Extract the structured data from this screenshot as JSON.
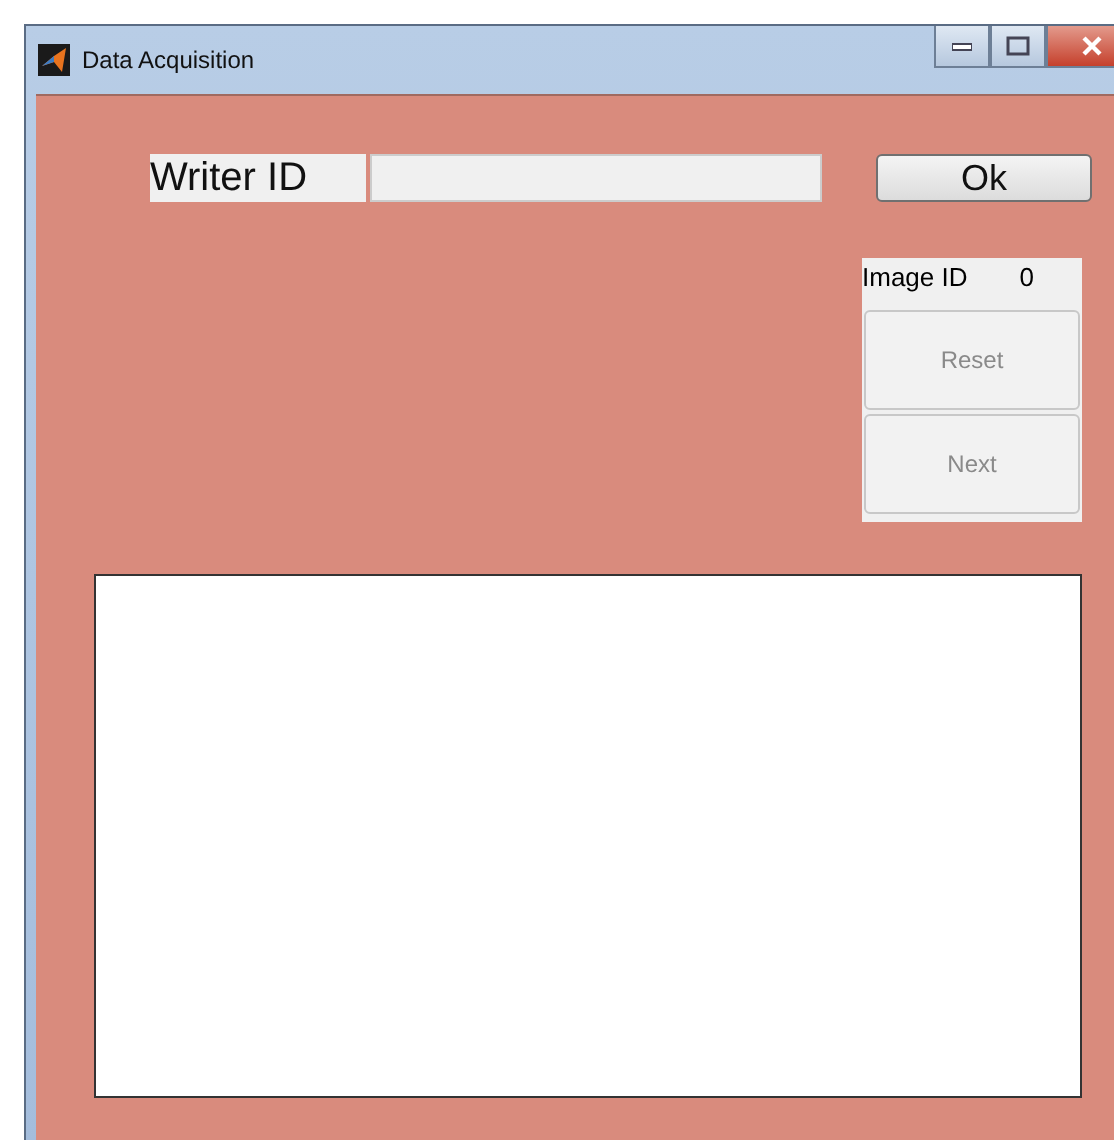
{
  "window": {
    "title": "Data Acquisition"
  },
  "writer_id": {
    "label": "Writer ID"
  },
  "ok_button": {
    "label": "Ok",
    "disabled": false
  },
  "image_panel": {
    "label": "Image ID",
    "value": "0"
  },
  "buttons": [
    {
      "label": "Reset",
      "disabled": true
    },
    {
      "label": "Next",
      "disabled": true
    }
  ]
}
